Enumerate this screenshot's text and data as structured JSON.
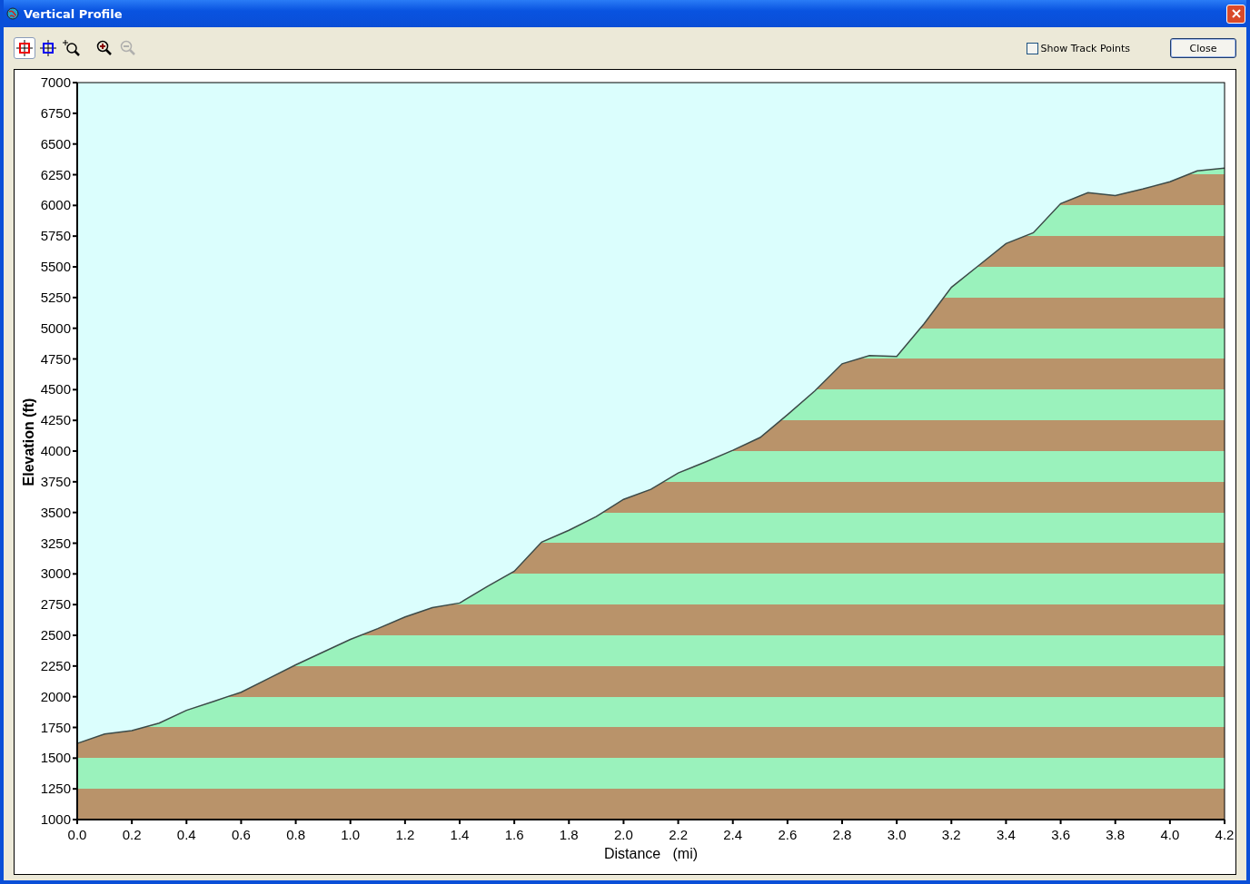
{
  "window": {
    "title": "Vertical Profile"
  },
  "toolbar": {
    "tools": [
      {
        "kind": "crosshair-red",
        "selected": true,
        "disabled": false
      },
      {
        "kind": "crosshair-blue",
        "selected": false,
        "disabled": false
      },
      {
        "kind": "zoom-area",
        "selected": false,
        "disabled": false
      },
      {
        "kind": "zoom-in",
        "selected": false,
        "disabled": false
      },
      {
        "kind": "zoom-out",
        "selected": false,
        "disabled": true
      }
    ],
    "show_track_points": {
      "label": "Show Track Points",
      "checked": false
    },
    "close_button": "Close"
  },
  "chart": {
    "chart_data": {
      "type": "area",
      "xlabel": "Distance   (mi)",
      "ylabel": "Elevation (ft)",
      "x": [
        0,
        0.1,
        0.2,
        0.3,
        0.4,
        0.5,
        0.6,
        0.7,
        0.8,
        0.9,
        1.0,
        1.1,
        1.2,
        1.3,
        1.4,
        1.5,
        1.6,
        1.7,
        1.8,
        1.9,
        2.0,
        2.1,
        2.2,
        2.3,
        2.4,
        2.5,
        2.6,
        2.7,
        2.8,
        2.9,
        3.0,
        3.1,
        3.2,
        3.3,
        3.4,
        3.5,
        3.6,
        3.7,
        3.8,
        3.9,
        4.0,
        4.1,
        4.2
      ],
      "series": [
        {
          "color": "#b9936a",
          "values": [
            1620,
            1696,
            1725,
            1785,
            1890,
            1963,
            2037,
            2148,
            2260,
            2363,
            2467,
            2555,
            2650,
            2725,
            2763,
            2896,
            3022,
            3259,
            3356,
            3467,
            3607,
            3689,
            3822,
            3911,
            4007,
            4111,
            4296,
            4489,
            4711,
            4778,
            4770,
            5037,
            5333,
            5511,
            5689,
            5778,
            6015,
            6104,
            6081,
            6133,
            6193,
            6281,
            6304
          ]
        }
      ],
      "xlim": [
        0,
        4.2
      ],
      "ylim": [
        1000,
        7000
      ],
      "xticks": [
        {
          "value": 0,
          "label": "0.0"
        },
        {
          "value": 0.2,
          "label": "0.2"
        },
        {
          "value": 0.4,
          "label": "0.4"
        },
        {
          "value": 0.6,
          "label": "0.6"
        },
        {
          "value": 0.8,
          "label": "0.8"
        },
        {
          "value": 1.0,
          "label": "1.0"
        },
        {
          "value": 1.2,
          "label": "1.2"
        },
        {
          "value": 1.4,
          "label": "1.4"
        },
        {
          "value": 1.6,
          "label": "1.6"
        },
        {
          "value": 1.8,
          "label": "1.8"
        },
        {
          "value": 2.0,
          "label": "2.0"
        },
        {
          "value": 2.2,
          "label": "2.2"
        },
        {
          "value": 2.4,
          "label": "2.4"
        },
        {
          "value": 2.6,
          "label": "2.6"
        },
        {
          "value": 2.8,
          "label": "2.8"
        },
        {
          "value": 3.0,
          "label": "3.0"
        },
        {
          "value": 3.2,
          "label": "3.2"
        },
        {
          "value": 3.4,
          "label": "3.4"
        },
        {
          "value": 3.6,
          "label": "3.6"
        },
        {
          "value": 3.8,
          "label": "3.8"
        },
        {
          "value": 4.0,
          "label": "4.0"
        },
        {
          "value": 4.2,
          "label": "4.2"
        }
      ],
      "yticks": [
        1000,
        1250,
        1500,
        1750,
        2000,
        2250,
        2500,
        2750,
        3000,
        3250,
        3500,
        3750,
        4000,
        4250,
        4500,
        4750,
        5000,
        5250,
        5500,
        5750,
        6000,
        6250,
        6500,
        6750,
        7000
      ]
    }
  }
}
